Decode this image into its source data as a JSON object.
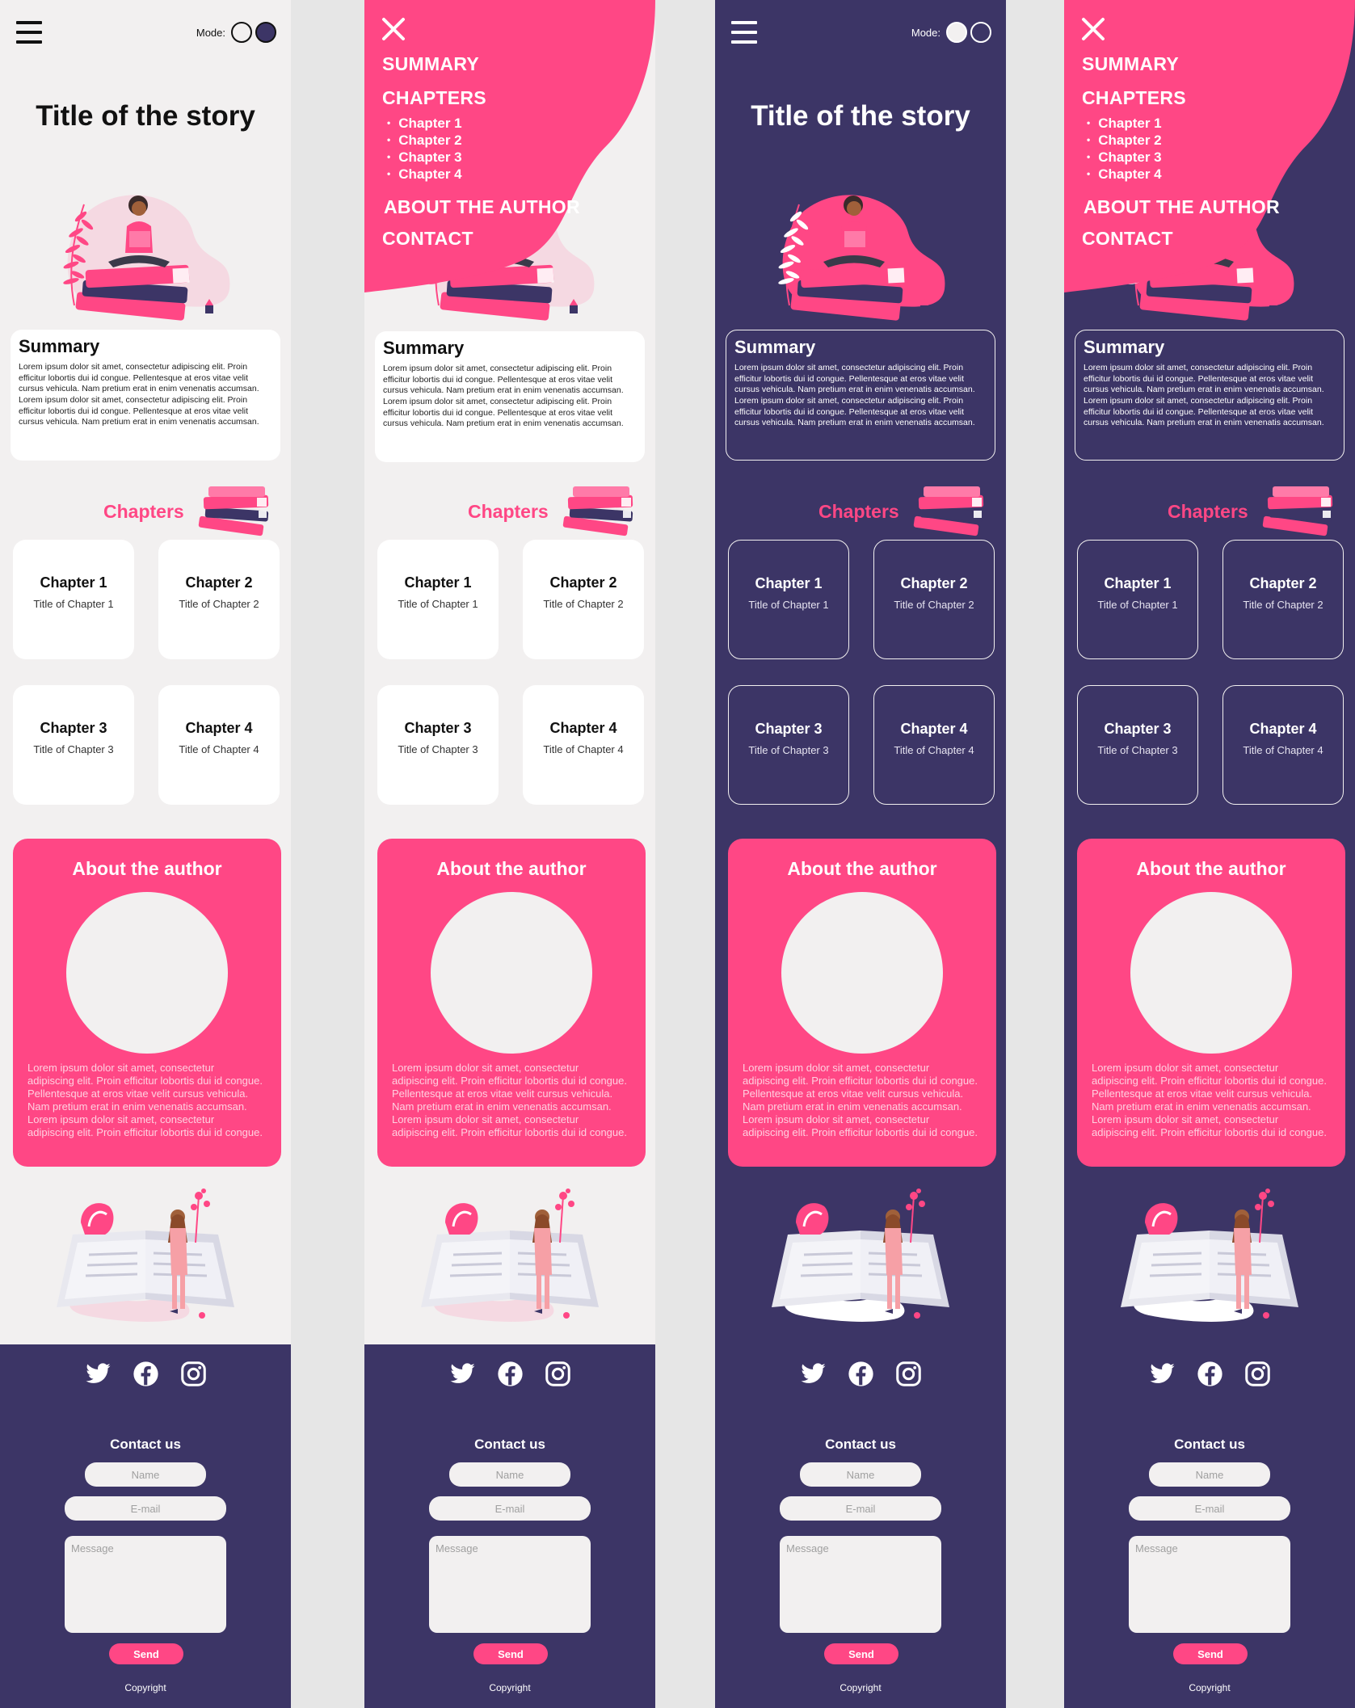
{
  "colors": {
    "accent": "#ff4785",
    "dark_bg": "#3c3566",
    "light_bg": "#f2f0f0",
    "card_light": "#ffffff"
  },
  "topbar": {
    "mode_label": "Mode:",
    "menu_icon": "hamburger-icon",
    "close_icon": "close-icon"
  },
  "story": {
    "title": "Title of the story"
  },
  "menu": {
    "summary": "SUMMARY",
    "chapters": "CHAPTERS",
    "chapter_items": [
      "Chapter 1",
      "Chapter 2",
      "Chapter 3",
      "Chapter 4"
    ],
    "about": "ABOUT THE AUTHOR",
    "contact": "CONTACT"
  },
  "summary": {
    "heading": "Summary",
    "text": "Lorem ipsum dolor sit amet, consectetur adipiscing elit. Proin efficitur lobortis dui id congue. Pellentesque at eros vitae velit cursus vehicula. Nam pretium erat in enim venenatis accumsan.  Lorem ipsum dolor sit amet, consectetur adipiscing elit. Proin efficitur lobortis dui id congue. Pellentesque at eros vitae velit cursus vehicula. Nam pretium erat in enim venenatis accumsan."
  },
  "chapters": {
    "heading": "Chapters",
    "items": [
      {
        "label": "Chapter 1",
        "subtitle": "Title of Chapter 1"
      },
      {
        "label": "Chapter 2",
        "subtitle": "Title of Chapter 2"
      },
      {
        "label": "Chapter 3",
        "subtitle": "Title of Chapter 3"
      },
      {
        "label": "Chapter 4",
        "subtitle": "Title of Chapter 4"
      }
    ]
  },
  "author": {
    "heading": "About the author",
    "text": "Lorem ipsum dolor sit amet, consectetur adipiscing elit. Proin efficitur lobortis dui id congue. Pellentesque at eros vitae velit cursus vehicula. Nam pretium erat in enim venenatis accumsan. Lorem ipsum dolor sit amet, consectetur adipiscing elit. Proin efficitur lobortis dui id congue."
  },
  "footer": {
    "social_icons": [
      "twitter-icon",
      "facebook-icon",
      "instagram-icon"
    ],
    "contact_heading": "Contact us",
    "name_placeholder": "Name",
    "email_placeholder": "E-mail",
    "message_placeholder": "Message",
    "send_label": "Send",
    "copyright": "Copyright"
  }
}
